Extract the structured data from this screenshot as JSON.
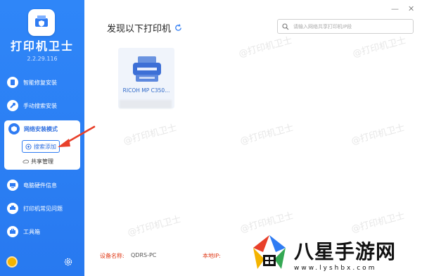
{
  "app": {
    "title": "打印机卫士",
    "version": "2.2.29.116"
  },
  "nav": {
    "repair": "智能修复安装",
    "manual": "手动搜索安装",
    "network": "网络安装模式",
    "search_add": "搜索添加",
    "share": "共享管理",
    "hardware": "电脑硬件信息",
    "faq": "打印机常见问题",
    "toolbox": "工具箱"
  },
  "window": {
    "minimize": "—",
    "close": "✕"
  },
  "main": {
    "section_title": "发现以下打印机",
    "search_placeholder": "请输入网络共享打印机IP段",
    "printers": [
      {
        "name": "RICOH MP C350..."
      }
    ]
  },
  "footer": {
    "device_label": "设备名称:",
    "device_value": "QDRS-PC",
    "ip_label": "本地IP:"
  },
  "watermark": "@打印机卫士",
  "brand": {
    "name": "八星手游网",
    "url": "www.lyshbx.com"
  },
  "colors": {
    "sidebar": "#2f86f8",
    "accent": "#2f7cf3",
    "arrow": "#e8402a"
  }
}
